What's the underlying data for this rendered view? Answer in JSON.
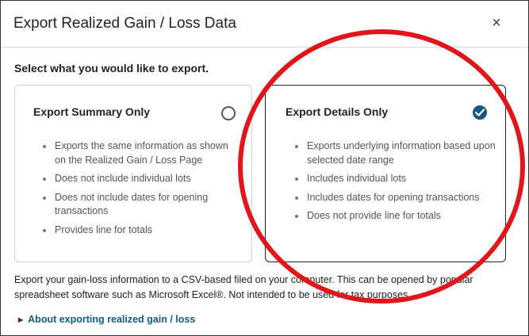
{
  "dialog": {
    "title": "Export Realized Gain / Loss Data",
    "close_glyph": "×",
    "prompt": "Select what you would like to export."
  },
  "options": [
    {
      "title": "Export Summary Only",
      "selected": false,
      "bullets": [
        "Exports the same information as shown on the Realized Gain / Loss Page",
        "Does not include individual lots",
        "Does not include dates for opening transactions",
        "Provides line for totals"
      ]
    },
    {
      "title": "Export Details Only",
      "selected": true,
      "bullets": [
        "Exports underlying information based upon selected date range",
        "Includes individual lots",
        "Includes dates for opening transactions",
        "Does not provide line for totals"
      ]
    }
  ],
  "description": "Export your gain-loss information to a CSV-based filed on your computer. This can be opened by popular spreadsheet software such as Microsoft Excel®. Not intended to be used for tax purposes.",
  "about_link": "About exporting realized gain / loss",
  "colors": {
    "selected_radio": "#16587d",
    "link": "#0f5b8c",
    "annotation_circle": "#e0161b"
  },
  "icons": {
    "close": "close-icon",
    "radio_unselected": "radio-empty-icon",
    "radio_selected": "checkmark-circle-icon",
    "expand": "triangle-right-icon"
  }
}
